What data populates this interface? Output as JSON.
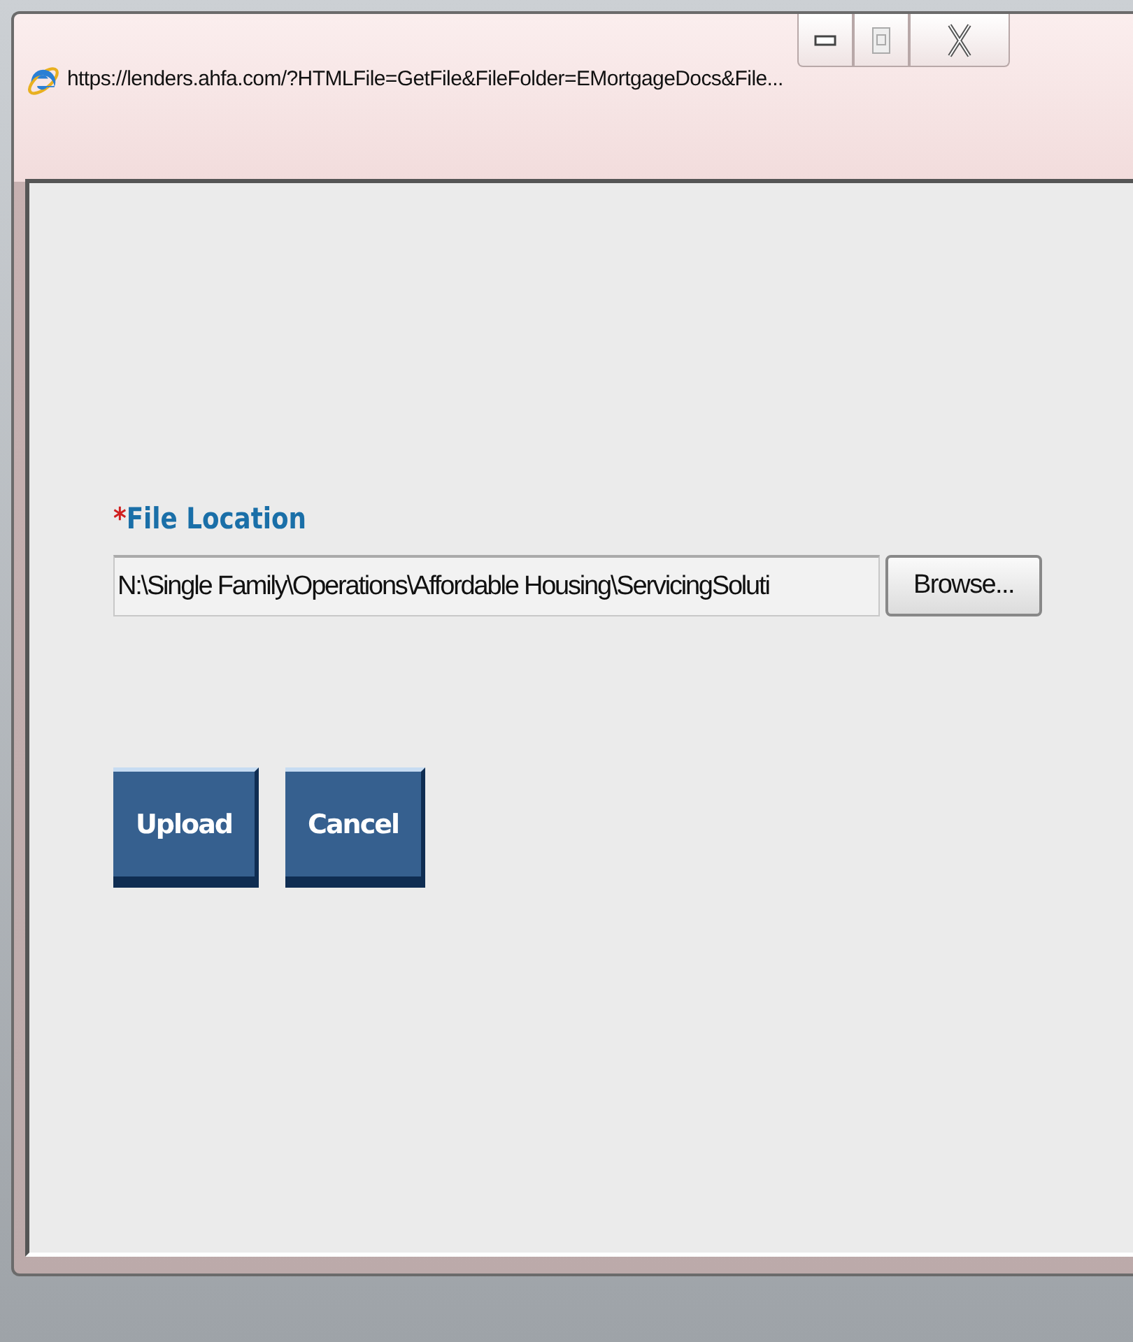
{
  "window": {
    "title": "https://lenders.ahfa.com/?HTMLFile=GetFile&FileFolder=EMortgageDocs&File..."
  },
  "form": {
    "required_mark": "*",
    "label": "File Location",
    "file_path": "N:\\Single Family\\Operations\\Affordable Housing\\ServicingSoluti",
    "browse_button": "Browse..."
  },
  "buttons": [
    "Upload",
    "Cancel"
  ]
}
